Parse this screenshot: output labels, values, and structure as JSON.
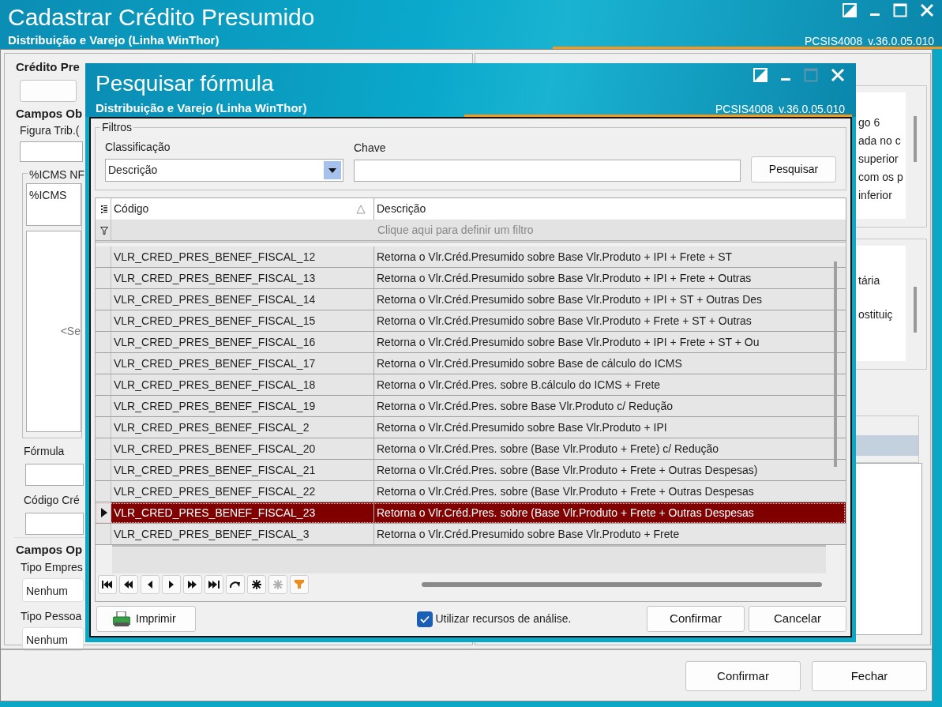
{
  "window": {
    "title": "Cadastrar Crédito Presumido",
    "subtitle": "Distribuição e Varejo (Linha WinThor)",
    "program": "PCSIS4008",
    "version": "v.36.0.05.010",
    "controls": [
      {
        "kind": "restore",
        "disabled": false
      },
      {
        "kind": "minimize",
        "disabled": false
      },
      {
        "kind": "maximize",
        "disabled": false
      },
      {
        "kind": "close",
        "disabled": false
      }
    ]
  },
  "left_panel": {
    "section_1": "Crédito Pre",
    "section_2": "Campos Ob",
    "figura_label": "Figura Trib.(",
    "icms_group": "%ICMS NF",
    "icms_item": "%ICMS",
    "empty_text": "<Se",
    "formula_label": "Fórmula",
    "codigo_label": "Código Cré",
    "section_3": "Campos Op",
    "tipo_empresa_label": "Tipo Empres",
    "tipo_empresa_value": "Nenhum",
    "tipo_pessoa_label": "Tipo Pessoa",
    "tipo_pessoa_value": "Nenhum"
  },
  "right_panel": {
    "lines_1": [
      "go 6",
      "ada no c",
      "superior",
      "com os p",
      "inferior"
    ],
    "lines_2": [
      "tária",
      "ostituiç"
    ]
  },
  "buttons": [
    "Confirmar",
    "Fechar"
  ],
  "dialog": {
    "title": "Pesquisar fórmula",
    "subtitle": "Distribuição e Varejo (Linha WinThor)",
    "program": "PCSIS4008",
    "version": "v.36.0.05.010",
    "controls": [
      {
        "kind": "restore",
        "disabled": false
      },
      {
        "kind": "minimize",
        "disabled": false
      },
      {
        "kind": "maximize",
        "disabled": true
      },
      {
        "kind": "close",
        "disabled": false
      }
    ],
    "filters": {
      "legend": "Filtros",
      "classification_label": "Classificação",
      "classification_value": "Descrição",
      "key_label": "Chave",
      "search_button": "Pesquisar"
    },
    "grid": {
      "columns": [
        {
          "label": "Código",
          "sorted": true
        },
        {
          "label": "Descrição",
          "sorted": false
        }
      ],
      "filter_hint": "Clique aqui para definir um filtro",
      "rows": [
        {
          "code": "VLR_CRED_PRES_BENEF_FISCAL_12",
          "description": "Retorna o Vlr.Créd.Presumido sobre Base Vlr.Produto + IPI + Frete + ST",
          "selected": false
        },
        {
          "code": "VLR_CRED_PRES_BENEF_FISCAL_13",
          "description": "Retorna o Vlr.Créd.Presumido sobre Base Vlr.Produto + IPI + Frete + Outras",
          "selected": false
        },
        {
          "code": "VLR_CRED_PRES_BENEF_FISCAL_14",
          "description": "Retorna o Vlr.Créd.Presumido sobre Base Vlr.Produto + IPI + ST + Outras Des",
          "selected": false
        },
        {
          "code": "VLR_CRED_PRES_BENEF_FISCAL_15",
          "description": "Retorna o Vlr.Créd.Presumido sobre Base Vlr.Produto + Frete + ST + Outras",
          "selected": false
        },
        {
          "code": "VLR_CRED_PRES_BENEF_FISCAL_16",
          "description": "Retorna o Vlr.Créd.Presumido sobre Base Vlr.Produto + IPI + Frete + ST + Ou",
          "selected": false
        },
        {
          "code": "VLR_CRED_PRES_BENEF_FISCAL_17",
          "description": "Retorna o Vlr.Créd.Presumido sobre Base de cálculo do ICMS",
          "selected": false
        },
        {
          "code": "VLR_CRED_PRES_BENEF_FISCAL_18",
          "description": "Retorna o Vlr.Créd.Pres. sobre B.cálculo do ICMS + Frete",
          "selected": false
        },
        {
          "code": "VLR_CRED_PRES_BENEF_FISCAL_19",
          "description": "Retorna o Vlr.Créd.Pres. sobre Base Vlr.Produto c/ Redução",
          "selected": false
        },
        {
          "code": "VLR_CRED_PRES_BENEF_FISCAL_2",
          "description": "Retorna o Vlr.Créd.Presumido sobre Base Vlr.Produto + IPI",
          "selected": false
        },
        {
          "code": "VLR_CRED_PRES_BENEF_FISCAL_20",
          "description": "Retorna o Vlr.Créd.Pres. sobre (Base Vlr.Produto + Frete) c/ Redução",
          "selected": false
        },
        {
          "code": "VLR_CRED_PRES_BENEF_FISCAL_21",
          "description": "Retorna o Vlr.Créd.Pres. sobre (Base Vlr.Produto + Frete + Outras Despesas)",
          "selected": false
        },
        {
          "code": "VLR_CRED_PRES_BENEF_FISCAL_22",
          "description": "Retorna o Vlr.Créd.Pres. sobre (Base Vlr.Produto + Frete + Outras Despesas",
          "selected": false
        },
        {
          "code": "VLR_CRED_PRES_BENEF_FISCAL_23",
          "description": "Retorna o Vlr.Créd.Pres. sobre (Base Vlr.Produto + Frete + Outras Despesas",
          "selected": true
        },
        {
          "code": "VLR_CRED_PRES_BENEF_FISCAL_3",
          "description": "Retorna o Vlr.Créd.Presumido sobre Base Vlr.Produto + Frete",
          "selected": false
        }
      ],
      "navigator": [
        {
          "kind": "first",
          "disabled": false
        },
        {
          "kind": "prior-page",
          "disabled": false
        },
        {
          "kind": "prior",
          "disabled": false
        },
        {
          "kind": "next",
          "disabled": false
        },
        {
          "kind": "next-page",
          "disabled": false
        },
        {
          "kind": "last",
          "disabled": false
        },
        {
          "kind": "refresh",
          "disabled": false
        },
        {
          "kind": "insert",
          "disabled": false
        },
        {
          "kind": "insert",
          "disabled": true
        },
        {
          "kind": "filter",
          "disabled": false
        }
      ]
    },
    "print_button": "Imprimir",
    "analysis": {
      "label": "Utilizar recursos de análise.",
      "checked": true
    },
    "buttons": [
      "Confirmar",
      "Cancelar"
    ]
  }
}
